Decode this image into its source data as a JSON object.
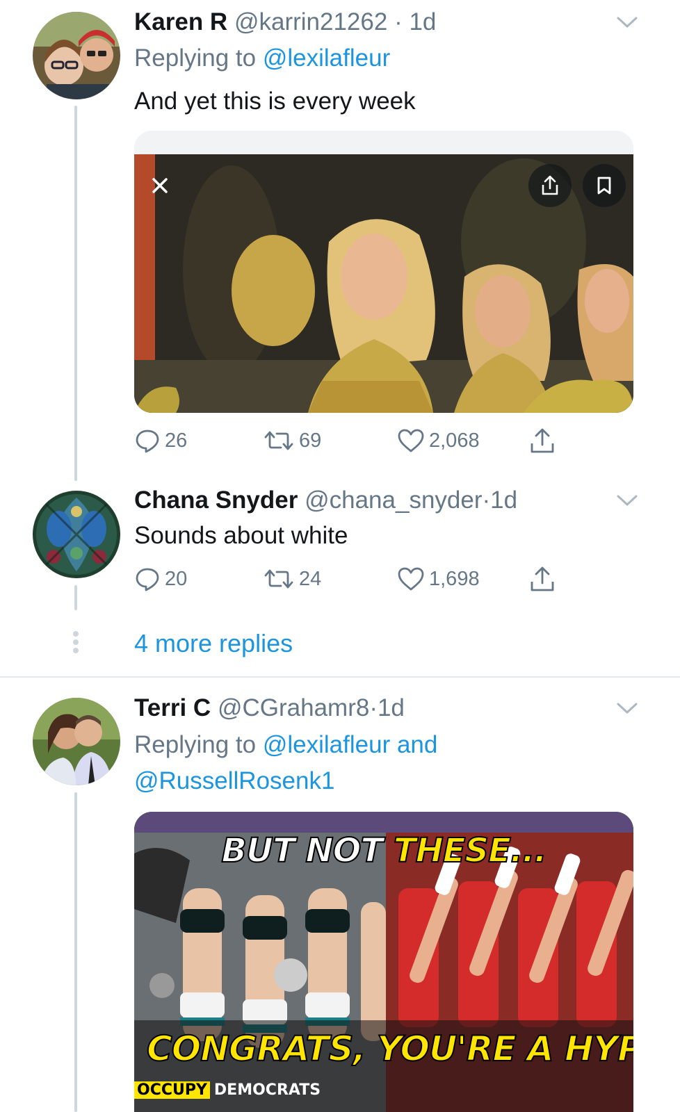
{
  "tweets": [
    {
      "name": "Karen R",
      "handle": "@karrin21262",
      "dot": "·",
      "time": "1d",
      "replying_prefix": "Replying to",
      "mentions": [
        "@lexilafleur"
      ],
      "text": "And yet this is every week",
      "counts": {
        "reply": "26",
        "retweet": "69",
        "like": "2,068"
      }
    },
    {
      "name": "Chana Snyder",
      "handle": "@chana_snyder",
      "dot": "·",
      "time": "1d",
      "text": "Sounds about white",
      "counts": {
        "reply": "20",
        "retweet": "24",
        "like": "1,698"
      }
    },
    {
      "name": "Terri C",
      "handle": "@CGrahamr8",
      "dot": "·",
      "time": "1d",
      "replying_prefix": "Replying to",
      "mentions": [
        "@lexilafleur",
        "@RussellRosenk1"
      ],
      "mention_joiner": "and"
    }
  ],
  "more_replies": "4 more replies",
  "meme": {
    "top_white": "BUT NOT ",
    "top_yellow": "THESE...",
    "bottom": "CONGRATS, YOU'RE A HYPOCRITE.",
    "brand_1": "OCCUPY",
    "brand_2": "DEMOCRATS"
  },
  "icons": {
    "reply": "reply-icon",
    "retweet": "retweet-icon",
    "like": "like-icon",
    "share": "share-icon",
    "chevron": "chevron-down-icon",
    "close": "close-icon",
    "bookmark": "bookmark-icon"
  },
  "colors": {
    "link": "#1b95e0",
    "secondary": "#657786",
    "thread_line": "#ccd6dd"
  }
}
